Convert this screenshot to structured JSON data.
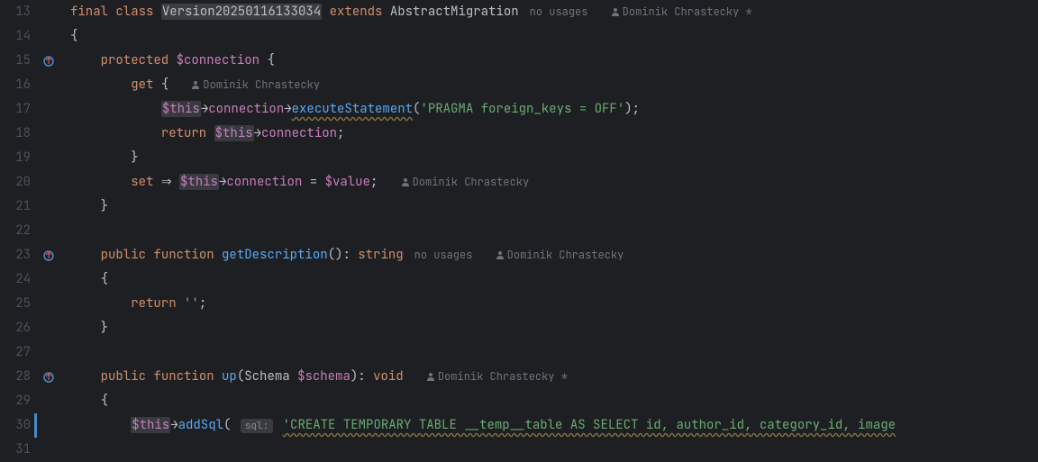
{
  "lines": [
    {
      "num": "13",
      "marker": null
    },
    {
      "num": "14",
      "marker": null
    },
    {
      "num": "15",
      "marker": "override"
    },
    {
      "num": "16",
      "marker": null
    },
    {
      "num": "17",
      "marker": null
    },
    {
      "num": "18",
      "marker": null
    },
    {
      "num": "19",
      "marker": null
    },
    {
      "num": "20",
      "marker": null
    },
    {
      "num": "21",
      "marker": null
    },
    {
      "num": "22",
      "marker": null
    },
    {
      "num": "23",
      "marker": "override"
    },
    {
      "num": "24",
      "marker": null
    },
    {
      "num": "25",
      "marker": null
    },
    {
      "num": "26",
      "marker": null
    },
    {
      "num": "27",
      "marker": null
    },
    {
      "num": "28",
      "marker": "override"
    },
    {
      "num": "29",
      "marker": null
    },
    {
      "num": "30",
      "marker": null,
      "caret": true
    },
    {
      "num": "31",
      "marker": null
    }
  ],
  "code": {
    "l13": {
      "kw1": "final",
      "kw2": "class",
      "cls": "Version20250116133034",
      "kw3": "extends",
      "super": "AbstractMigration",
      "hint": "no usages",
      "author": "Dominik Chrastecky *"
    },
    "l14": {
      "brace": "{"
    },
    "l15": {
      "kw": "protected",
      "var": "$connection",
      "brace": "{"
    },
    "l16": {
      "kw": "get",
      "brace": "{",
      "author": "Dominik Chrastecky"
    },
    "l17": {
      "this": "$this",
      "arrow1": "→",
      "prop1": "connection",
      "arrow2": "→",
      "method": "executeStatement",
      "paren1": "(",
      "str": "'PRAGMA foreign_keys = OFF'",
      "paren2": ");"
    },
    "l18": {
      "kw": "return",
      "this": "$this",
      "arrow": "→",
      "prop": "connection",
      "semi": ";"
    },
    "l19": {
      "brace": "}"
    },
    "l20": {
      "kw": "set",
      "arrow1": "⇒",
      "this": "$this",
      "arrow2": "→",
      "prop": "connection",
      "eq": "=",
      "var": "$value",
      "semi": ";",
      "author": "Dominik Chrastecky"
    },
    "l21": {
      "brace": "}"
    },
    "l23": {
      "kw1": "public",
      "kw2": "function",
      "method": "getDescription",
      "parens": "():",
      "type": "string",
      "hint": "no usages",
      "author": "Dominik Chrastecky"
    },
    "l24": {
      "brace": "{"
    },
    "l25": {
      "kw": "return",
      "str": "''",
      "semi": ";"
    },
    "l26": {
      "brace": "}"
    },
    "l28": {
      "kw1": "public",
      "kw2": "function",
      "method": "up",
      "paren1": "(",
      "ptype": "Schema",
      "param": "$schema",
      "paren2": "):",
      "type": "void",
      "author": "Dominik Chrastecky *"
    },
    "l29": {
      "brace": "{"
    },
    "l30": {
      "this": "$this",
      "arrow": "→",
      "method": "addSql",
      "paren": "(",
      "param_hint": "sql:",
      "str": "'CREATE TEMPORARY TABLE __temp__table AS SELECT id, author_id, category_id, image"
    }
  }
}
